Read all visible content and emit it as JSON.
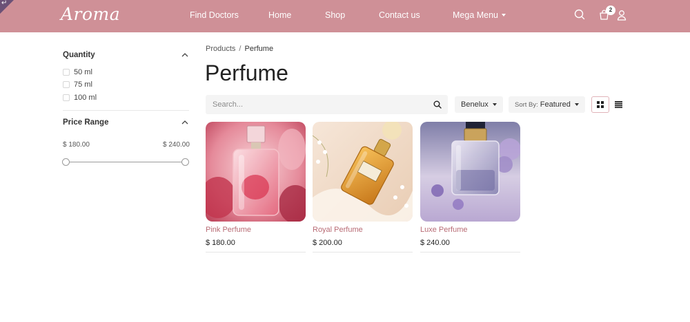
{
  "header": {
    "logo": "Aroma",
    "nav": [
      {
        "label": "Find Doctors"
      },
      {
        "label": "Home"
      },
      {
        "label": "Shop"
      },
      {
        "label": "Contact us"
      },
      {
        "label": "Mega Menu"
      }
    ],
    "cart_count": "2",
    "colors": {
      "bar": "#cf9097",
      "corner": "#6b5177"
    }
  },
  "sidebar": {
    "quantity": {
      "title": "Quantity",
      "options": [
        {
          "label": "50 ml",
          "checked": false
        },
        {
          "label": "75 ml",
          "checked": false
        },
        {
          "label": "100 ml",
          "checked": false
        }
      ]
    },
    "price_range": {
      "title": "Price Range",
      "min": "$ 180.00",
      "max": "$ 240.00"
    }
  },
  "breadcrumb": {
    "parent": "Products",
    "separator": "/",
    "current": "Perfume"
  },
  "page_title": "Perfume",
  "toolbar": {
    "search_placeholder": "Search...",
    "region": "Benelux",
    "sort_prefix": "Sort By:",
    "sort_value": "Featured",
    "active_view": "grid"
  },
  "products": [
    {
      "name": "Pink Perfume",
      "price": "$ 180.00",
      "image": "pink-perfume-bottle"
    },
    {
      "name": "Royal Perfume",
      "price": "$ 200.00",
      "image": "amber-perfume-bottle"
    },
    {
      "name": "Luxe Perfume",
      "price": "$ 240.00",
      "image": "lilac-perfume-bottle"
    }
  ]
}
